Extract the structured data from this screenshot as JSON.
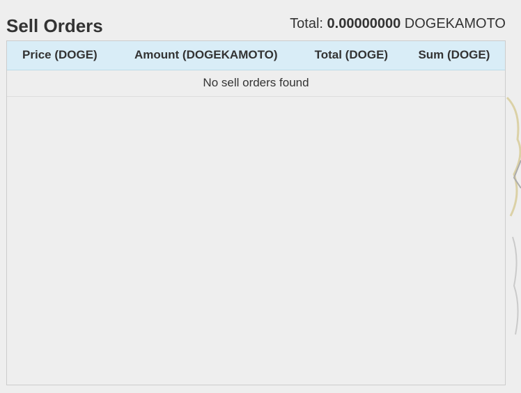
{
  "header": {
    "title": "Sell Orders",
    "total_prefix": "Total:",
    "total_amount": "0.00000000",
    "total_unit": "DOGEKAMOTO"
  },
  "table": {
    "columns": [
      "Price (DOGE)",
      "Amount (DOGEKAMOTO)",
      "Total (DOGE)",
      "Sum (DOGE)"
    ],
    "empty_message": "No sell orders found"
  },
  "colors": {
    "page_bg": "#eeeeee",
    "header_row_bg": "#d9edf7",
    "text": "#333333",
    "border": "#cccccc"
  }
}
